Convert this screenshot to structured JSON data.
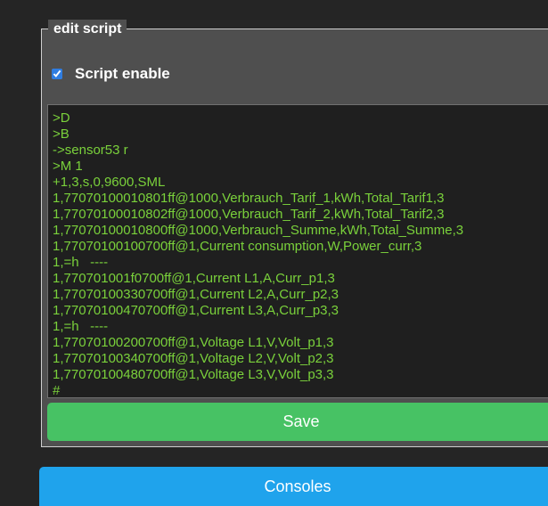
{
  "editor": {
    "legend": "edit script",
    "enable_label": "Script enable",
    "enable_checked": true,
    "script_lines": [
      ">D",
      ">B",
      "->sensor53 r",
      ">M 1",
      "+1,3,s,0,9600,SML",
      "1,77070100010801ff@1000,Verbrauch_Tarif_1,kWh,Total_Tarif1,3",
      "1,77070100010802ff@1000,Verbrauch_Tarif_2,kWh,Total_Tarif2,3",
      "1,77070100010800ff@1000,Verbrauch_Summe,kWh,Total_Summe,3",
      "1,77070100100700ff@1,Current consumption,W,Power_curr,3",
      "1,=h   ----",
      "1,770701001f0700ff@1,Current L1,A,Curr_p1,3",
      "1,77070100330700ff@1,Current L2,A,Curr_p2,3",
      "1,77070100470700ff@1,Current L3,A,Curr_p3,3",
      "1,=h   ----",
      "1,77070100200700ff@1,Voltage L1,V,Volt_p1,3",
      "1,77070100340700ff@1,Voltage L2,V,Volt_p2,3",
      "1,77070100480700ff@1,Voltage L3,V,Volt_p3,3",
      "#"
    ],
    "save_label": "Save"
  },
  "footer": {
    "consoles_label": "Consoles"
  },
  "colors": {
    "background": "#252525",
    "panel": "#4f4f4f",
    "script_text": "#7ad13b",
    "save_button": "#47c264",
    "consoles_button": "#1fa3ec"
  }
}
